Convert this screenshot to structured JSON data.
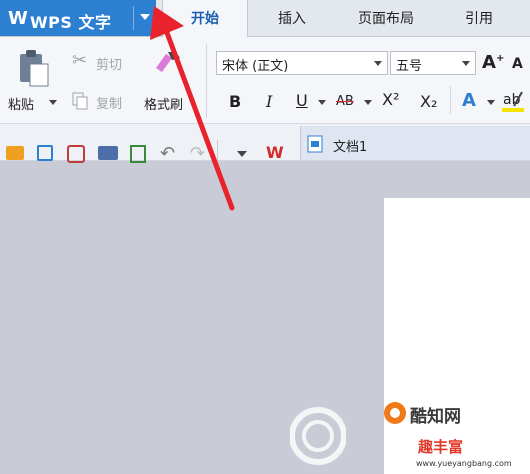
{
  "app": {
    "logo": "W",
    "name": "WPS 文字"
  },
  "tabs": [
    {
      "label": "开始",
      "active": true
    },
    {
      "label": "插入",
      "active": false
    },
    {
      "label": "页面布局",
      "active": false
    },
    {
      "label": "引用",
      "active": false
    }
  ],
  "clipboard": {
    "paste": "粘贴",
    "cut": "剪切",
    "copy": "复制",
    "format_painter": "格式刷"
  },
  "font": {
    "family": "宋体 (正文)",
    "size": "五号"
  },
  "format_buttons": [
    "B",
    "I",
    "U",
    "AB",
    "X²",
    "X₂",
    "A"
  ],
  "document": {
    "tab_title": "文档1"
  },
  "watermark": {
    "site_name": "酷知网",
    "brand": "趣丰富",
    "url": "www.yueyangbang.com"
  },
  "colors": {
    "accent": "#2d7fd2",
    "arrow": "#e8232b",
    "page_bg": "#c9ccd6"
  }
}
